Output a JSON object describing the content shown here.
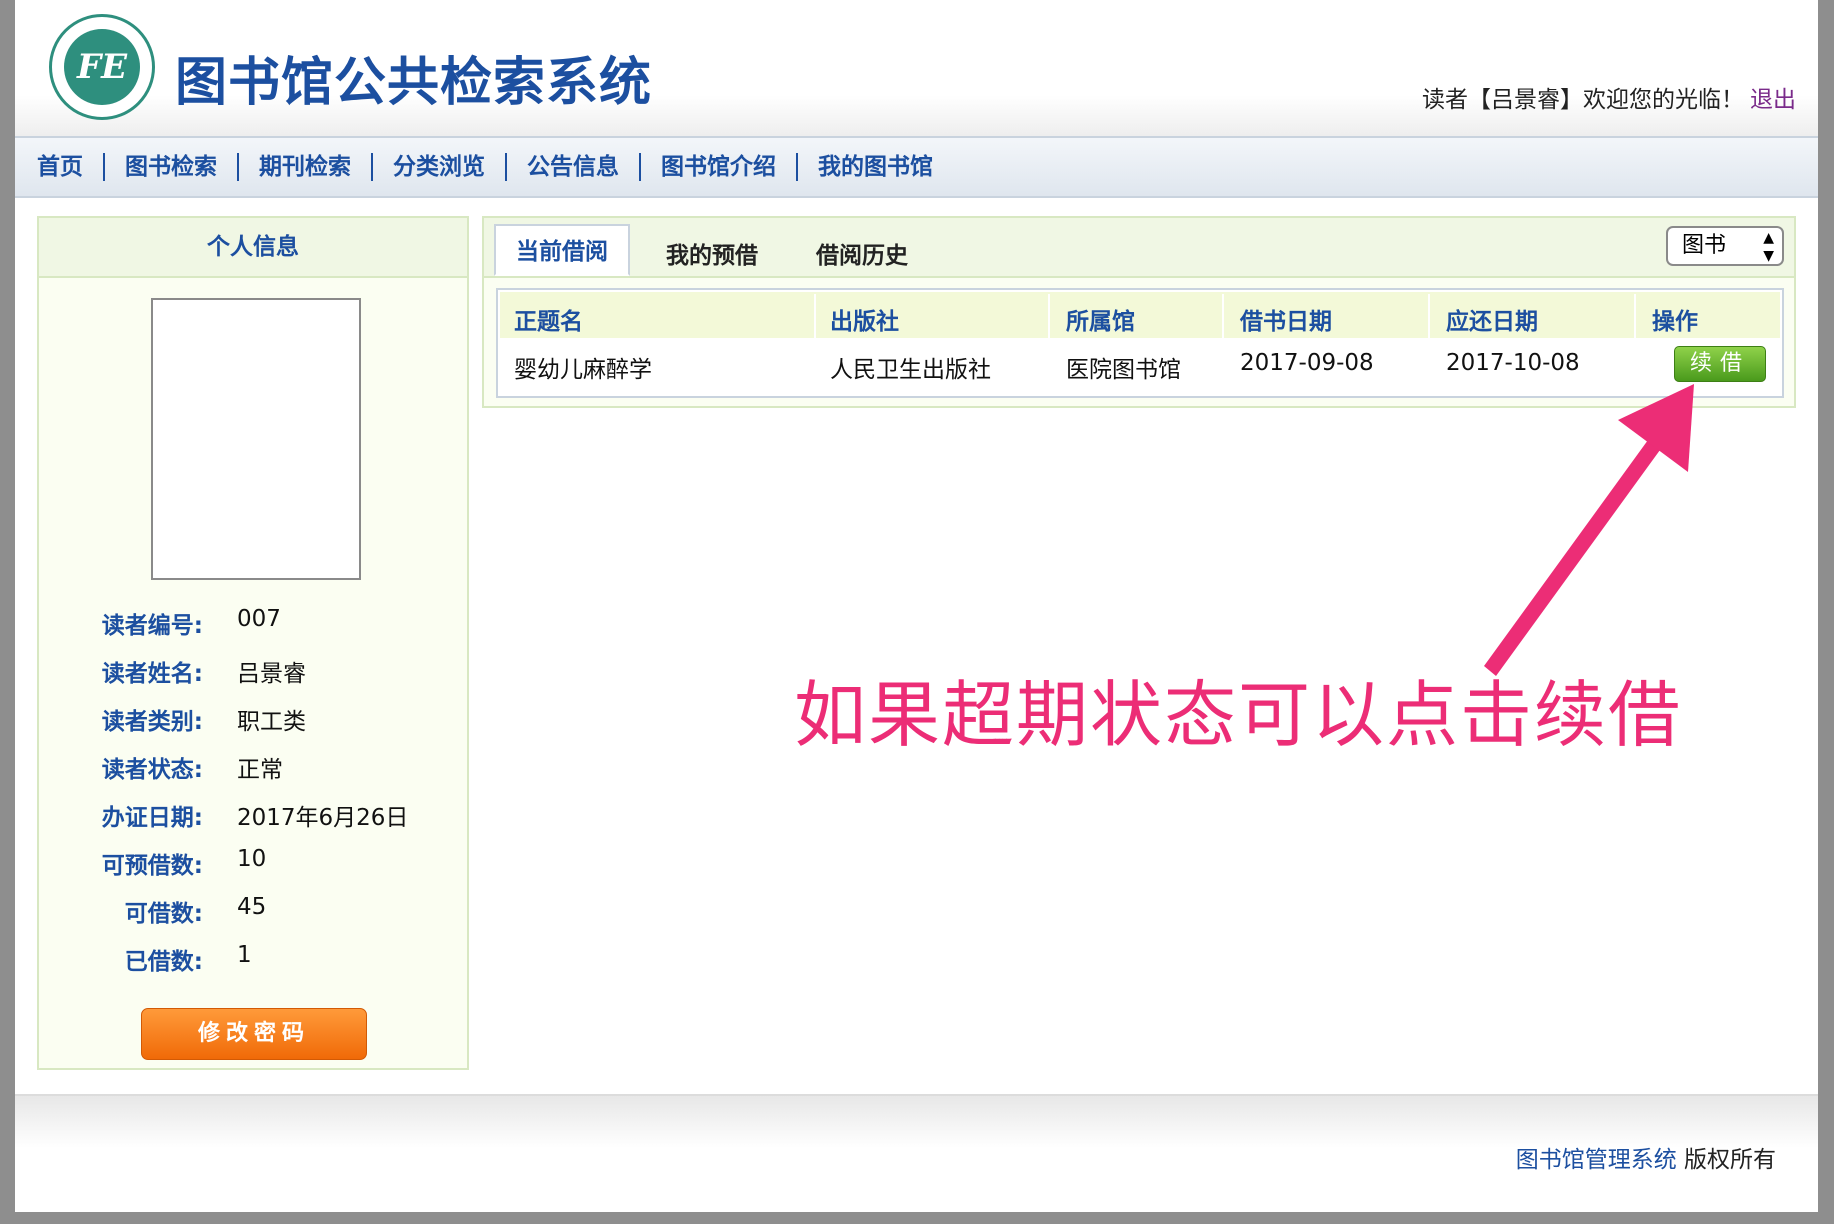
{
  "header": {
    "logo_text": "FE",
    "title": "图书馆公共检索系统",
    "welcome": "读者【吕景睿】欢迎您的光临！",
    "logout": "退出"
  },
  "nav": {
    "items": [
      "首页",
      "图书检索",
      "期刊检索",
      "分类浏览",
      "公告信息",
      "图书馆介绍",
      "我的图书馆"
    ]
  },
  "profile": {
    "heading": "个人信息",
    "fields": [
      {
        "label": "读者编号:",
        "value": "007"
      },
      {
        "label": "读者姓名:",
        "value": "吕景睿"
      },
      {
        "label": "读者类别:",
        "value": "职工类"
      },
      {
        "label": "读者状态:",
        "value": "正常"
      },
      {
        "label": "办证日期:",
        "value": "2017年6月26日"
      },
      {
        "label": "可预借数:",
        "value": "10"
      },
      {
        "label": "可借数:",
        "value": "45"
      },
      {
        "label": "已借数:",
        "value": "1"
      }
    ],
    "change_password": "修改密码"
  },
  "loans": {
    "tabs": [
      "当前借阅",
      "我的预借",
      "借阅历史"
    ],
    "type_select": "图书",
    "columns": [
      "正题名",
      "出版社",
      "所属馆",
      "借书日期",
      "应还日期",
      "操作"
    ],
    "rows": [
      {
        "title": "婴幼儿麻醉学",
        "publisher": "人民卫生出版社",
        "library": "医院图书馆",
        "borrow_date": "2017-09-08",
        "due_date": "2017-10-08",
        "action": "续借"
      }
    ]
  },
  "annotation": {
    "text": "如果超期状态可以点击续借",
    "color": "#ec2d76"
  },
  "footer": {
    "system": "图书馆管理系统",
    "rights": "版权所有"
  }
}
